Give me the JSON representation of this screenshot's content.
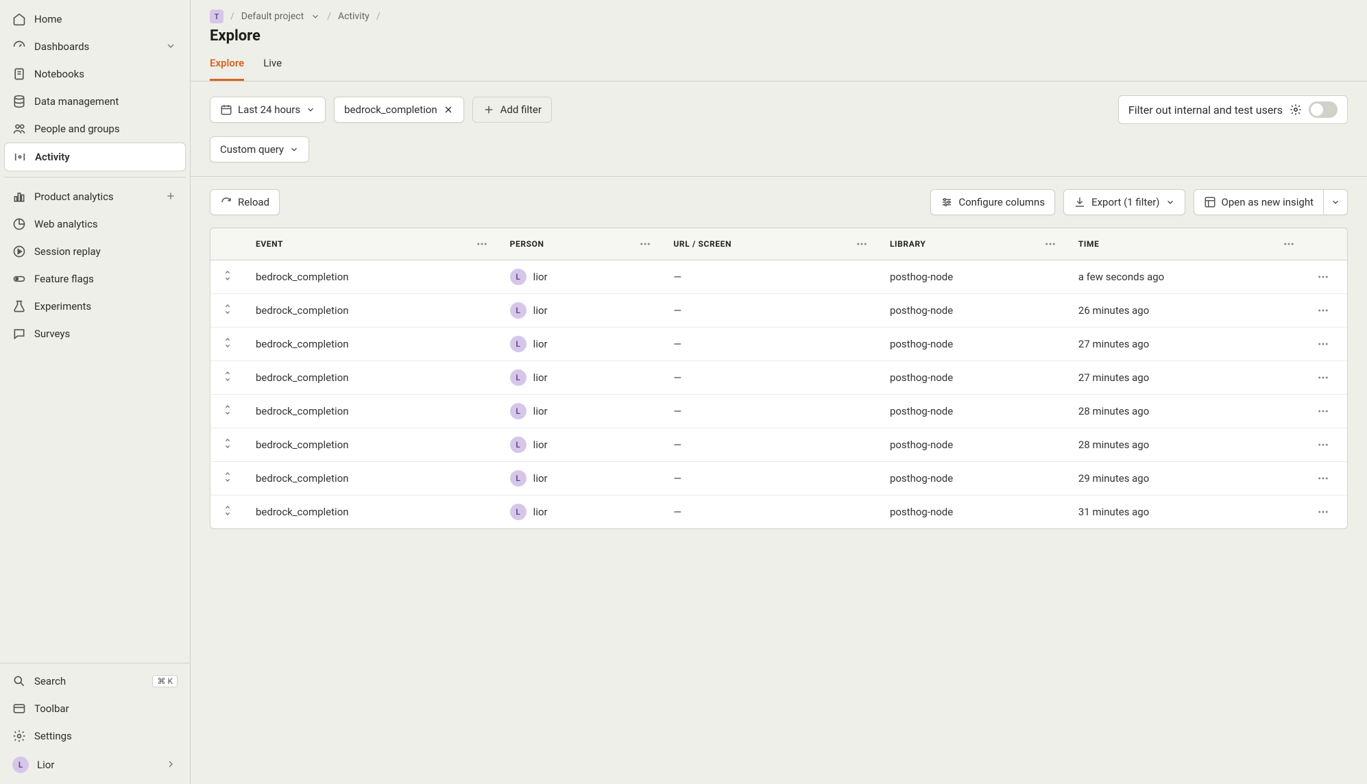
{
  "sidebar": {
    "main": [
      {
        "label": "Home",
        "icon": "home-icon"
      },
      {
        "label": "Dashboards",
        "icon": "gauge-icon",
        "chevron": true
      },
      {
        "label": "Notebooks",
        "icon": "notebook-icon"
      },
      {
        "label": "Data management",
        "icon": "database-icon"
      },
      {
        "label": "People and groups",
        "icon": "people-icon"
      },
      {
        "label": "Activity",
        "icon": "activity-icon",
        "active": true
      }
    ],
    "tools": [
      {
        "label": "Product analytics",
        "icon": "bar-chart-icon",
        "plus": true
      },
      {
        "label": "Web analytics",
        "icon": "pie-icon"
      },
      {
        "label": "Session replay",
        "icon": "replay-icon"
      },
      {
        "label": "Feature flags",
        "icon": "toggle-icon"
      },
      {
        "label": "Experiments",
        "icon": "flask-icon"
      },
      {
        "label": "Surveys",
        "icon": "chat-icon"
      }
    ],
    "bottom": {
      "search_label": "Search",
      "search_kbd": "⌘ K",
      "toolbar_label": "Toolbar",
      "settings_label": "Settings",
      "user_label": "Lior",
      "user_initial": "L"
    }
  },
  "breadcrumb": {
    "project_initial": "T",
    "project": "Default project",
    "section": "Activity"
  },
  "page_title": "Explore",
  "tabs": [
    {
      "label": "Explore",
      "active": true
    },
    {
      "label": "Live"
    }
  ],
  "filters": {
    "daterange_label": "Last 24 hours",
    "event_filter_label": "bedrock_completion",
    "add_filter_label": "Add filter",
    "internal_filter_label": "Filter out internal and test users",
    "custom_query_label": "Custom query"
  },
  "toolbar": {
    "reload_label": "Reload",
    "configure_label": "Configure columns",
    "export_label": "Export (1 filter)",
    "open_insight_label": "Open as new insight"
  },
  "table": {
    "headers": {
      "event": "EVENT",
      "person": "PERSON",
      "url": "URL / SCREEN",
      "library": "LIBRARY",
      "time": "TIME"
    },
    "rows": [
      {
        "event": "bedrock_completion",
        "person": "lior",
        "person_initial": "L",
        "url": "—",
        "library": "posthog-node",
        "time": "a few seconds ago"
      },
      {
        "event": "bedrock_completion",
        "person": "lior",
        "person_initial": "L",
        "url": "—",
        "library": "posthog-node",
        "time": "26 minutes ago"
      },
      {
        "event": "bedrock_completion",
        "person": "lior",
        "person_initial": "L",
        "url": "—",
        "library": "posthog-node",
        "time": "27 minutes ago"
      },
      {
        "event": "bedrock_completion",
        "person": "lior",
        "person_initial": "L",
        "url": "—",
        "library": "posthog-node",
        "time": "27 minutes ago"
      },
      {
        "event": "bedrock_completion",
        "person": "lior",
        "person_initial": "L",
        "url": "—",
        "library": "posthog-node",
        "time": "28 minutes ago"
      },
      {
        "event": "bedrock_completion",
        "person": "lior",
        "person_initial": "L",
        "url": "—",
        "library": "posthog-node",
        "time": "28 minutes ago"
      },
      {
        "event": "bedrock_completion",
        "person": "lior",
        "person_initial": "L",
        "url": "—",
        "library": "posthog-node",
        "time": "29 minutes ago"
      },
      {
        "event": "bedrock_completion",
        "person": "lior",
        "person_initial": "L",
        "url": "—",
        "library": "posthog-node",
        "time": "31 minutes ago"
      }
    ]
  }
}
